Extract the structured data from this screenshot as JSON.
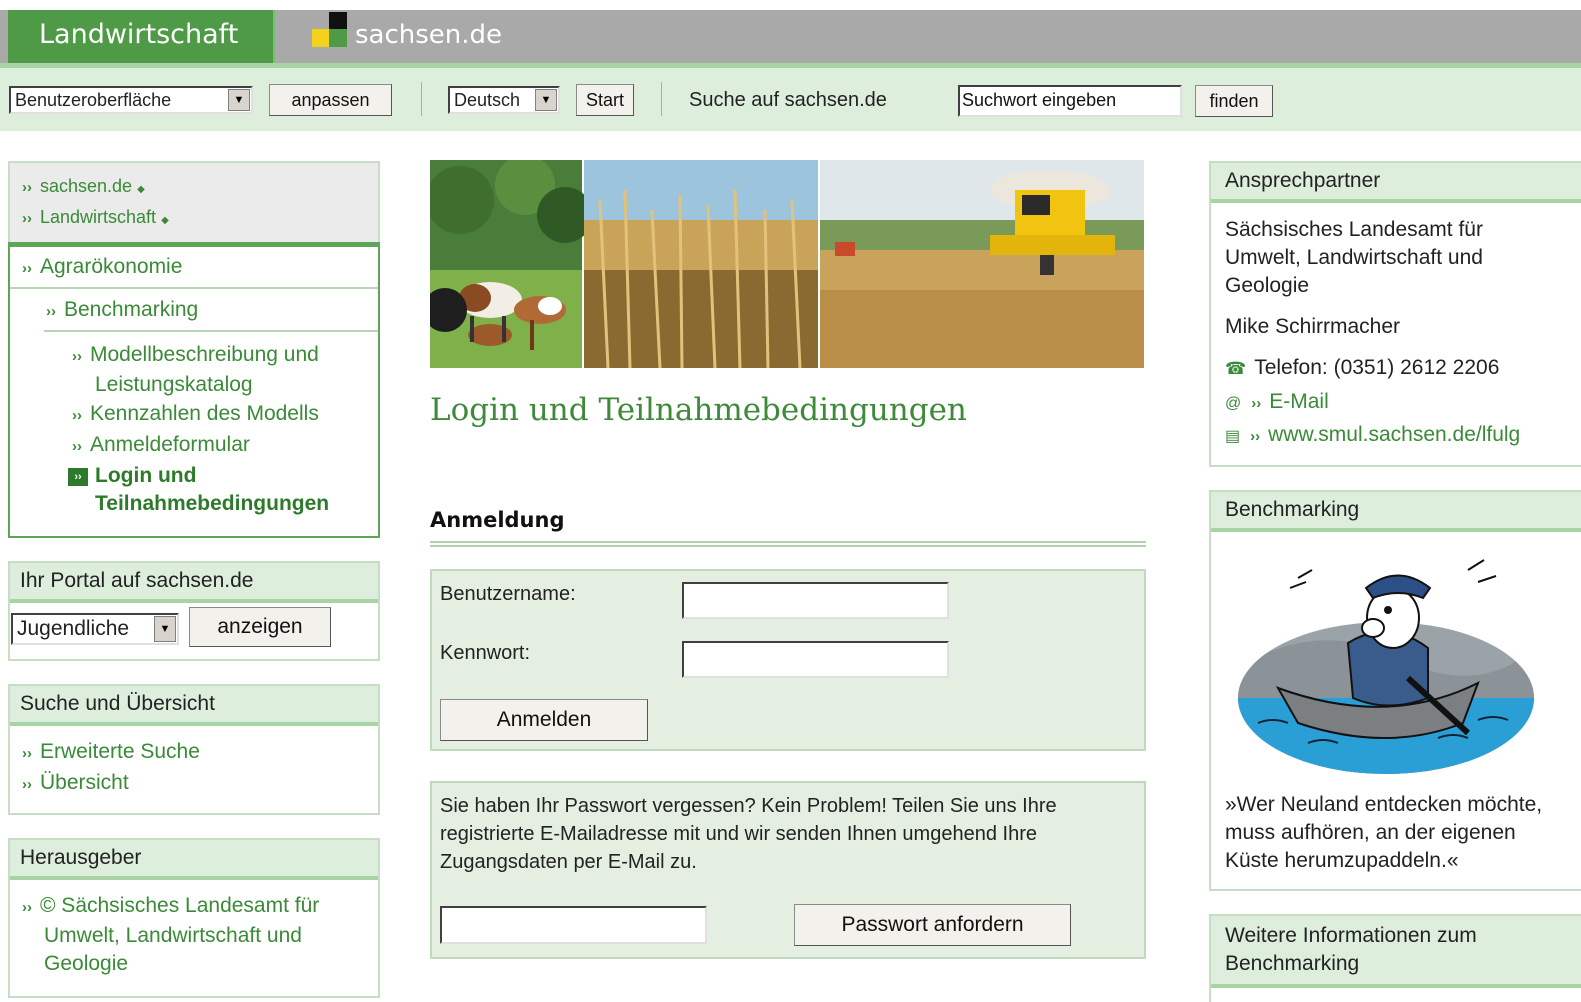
{
  "header": {
    "active_tab": "Landwirtschaft",
    "site_tab": "sachsen.de",
    "colors": {
      "brand_green": "#4e9a47",
      "bar_gray": "#a9a9a9",
      "toolbar_bg": "#ddeedd"
    }
  },
  "toolbar": {
    "ui_select": "Benutzeroberfläche",
    "customize_button": "anpassen",
    "language_select": "Deutsch",
    "start_button": "Start",
    "search_label": "Suche auf sachsen.de",
    "search_value": "Suchwort eingeben",
    "find_button": "finden"
  },
  "nav": {
    "top": [
      "sachsen.de",
      "Landwirtschaft"
    ],
    "section": "Agrarökonomie",
    "sub": "Benchmarking",
    "items": [
      {
        "line1": "Modellbeschreibung und",
        "line2": "Leistungskatalog"
      },
      {
        "line1": "Kennzahlen des Modells"
      },
      {
        "line1": "Anmeldeformular"
      },
      {
        "line1": "Login und",
        "line2": "Teilnahmebedingungen"
      }
    ]
  },
  "portal": {
    "title": "Ihr Portal auf sachsen.de",
    "select": "Jugendliche",
    "button": "anzeigen"
  },
  "search_overview": {
    "title": "Suche und Übersicht",
    "links": [
      "Erweiterte Suche",
      "Übersicht"
    ]
  },
  "publisher": {
    "title": "Herausgeber",
    "line1": "© Sächsisches Landesamt für",
    "line2": "Umwelt, Landwirtschaft und",
    "line3": "Geologie"
  },
  "main": {
    "page_title": "Login und Teilnahmebedingungen",
    "section_title": "Anmeldung",
    "username_label": "Benutzername:",
    "password_label": "Kennwort:",
    "login_button": "Anmelden",
    "forgot_line1": "Sie haben Ihr Passwort vergessen? Kein Problem! Teilen Sie uns Ihre",
    "forgot_line2": "registrierte E-Mailadresse mit und wir senden Ihnen umgehend Ihre",
    "forgot_line3": "Zugangsdaten per E-Mail zu.",
    "request_button": "Passwort anfordern"
  },
  "contact": {
    "title": "Ansprechpartner",
    "org1": "Sächsisches Landesamt für",
    "org2": "Umwelt, Landwirtschaft und",
    "org3": "Geologie",
    "person": "Mike Schirrmacher",
    "phone": "Telefon: (0351) 2612 2206",
    "email": "E-Mail",
    "web": "www.smul.sachsen.de/lfulg"
  },
  "benchmarking": {
    "title": "Benchmarking",
    "quote1": "»Wer Neuland entdecken möchte,",
    "quote2": "muss aufhören, an der eigenen",
    "quote3": "Küste herumzupaddeln.«"
  },
  "more_info": {
    "line1": "Weitere Informationen zum",
    "line2": "Benchmarking"
  }
}
